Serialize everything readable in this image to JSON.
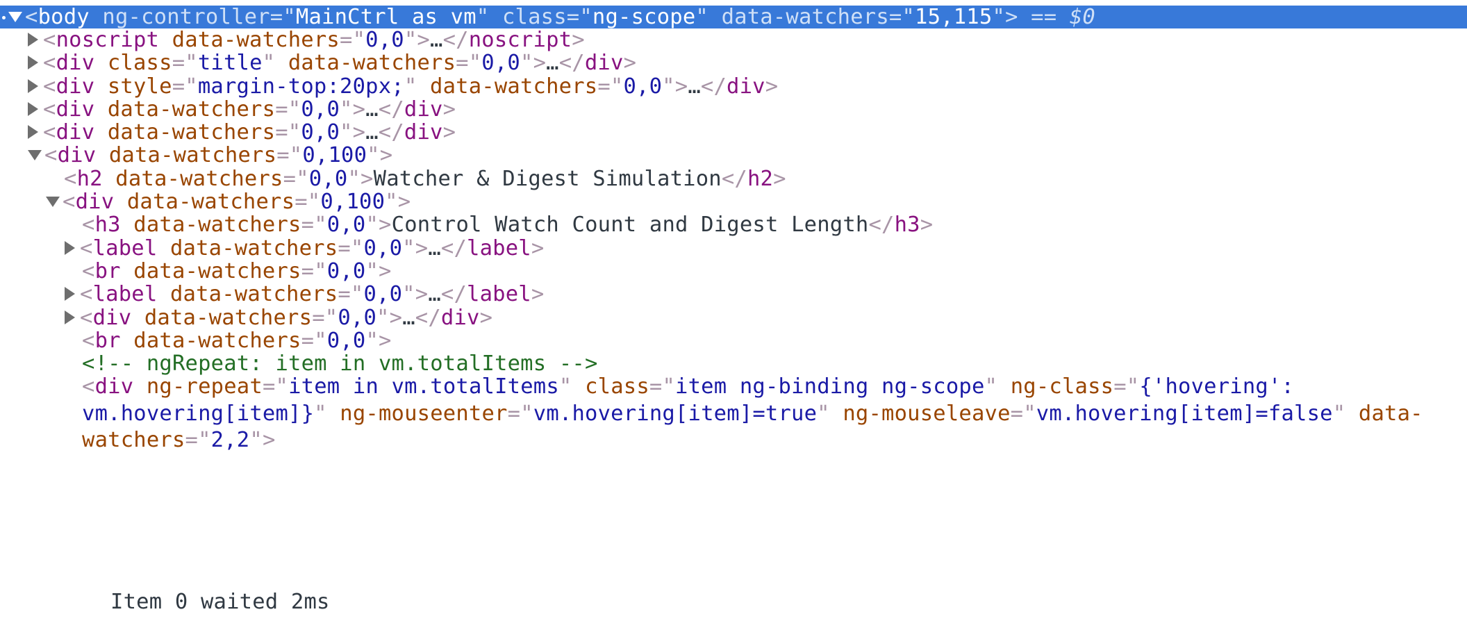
{
  "rows": [
    {
      "indent": 0,
      "selected": true,
      "dot": true,
      "arrow": "expanded",
      "kind": "open",
      "tag": "body",
      "attrs": [
        {
          "n": "ng-controller",
          "v": "MainCtrl as vm"
        },
        {
          "n": "class",
          "v": "ng-scope"
        },
        {
          "n": "data-watchers",
          "v": "15,115"
        }
      ],
      "suffix": " == ",
      "ref": "$0"
    },
    {
      "indent": 1,
      "arrow": "collapsed",
      "kind": "collapsed",
      "tag": "noscript",
      "attrs": [
        {
          "n": "data-watchers",
          "v": "0,0"
        }
      ],
      "ellipsis": "…"
    },
    {
      "indent": 1,
      "arrow": "collapsed",
      "kind": "collapsed",
      "tag": "div",
      "attrs": [
        {
          "n": "class",
          "v": "title"
        },
        {
          "n": "data-watchers",
          "v": "0,0"
        }
      ],
      "ellipsis": "…"
    },
    {
      "indent": 1,
      "arrow": "collapsed",
      "kind": "collapsed",
      "tag": "div",
      "attrs": [
        {
          "n": "style",
          "v": "margin-top:20px;"
        },
        {
          "n": "data-watchers",
          "v": "0,0"
        }
      ],
      "ellipsis": "…"
    },
    {
      "indent": 1,
      "arrow": "collapsed",
      "kind": "collapsed",
      "tag": "div",
      "attrs": [
        {
          "n": "data-watchers",
          "v": "0,0"
        }
      ],
      "ellipsis": "…"
    },
    {
      "indent": 1,
      "arrow": "collapsed",
      "kind": "collapsed",
      "tag": "div",
      "attrs": [
        {
          "n": "data-watchers",
          "v": "0,0"
        }
      ],
      "ellipsis": "…"
    },
    {
      "indent": 1,
      "arrow": "expanded",
      "kind": "open",
      "tag": "div",
      "attrs": [
        {
          "n": "data-watchers",
          "v": "0,100"
        }
      ]
    },
    {
      "indent": 2,
      "arrow": "none",
      "kind": "inline",
      "tag": "h2",
      "attrs": [
        {
          "n": "data-watchers",
          "v": "0,0"
        }
      ],
      "text": "Watcher & Digest Simulation"
    },
    {
      "indent": 2,
      "arrow": "expanded",
      "kind": "open",
      "tag": "div",
      "attrs": [
        {
          "n": "data-watchers",
          "v": "0,100"
        }
      ]
    },
    {
      "indent": 3,
      "arrow": "none",
      "kind": "inline",
      "tag": "h3",
      "attrs": [
        {
          "n": "data-watchers",
          "v": "0,0"
        }
      ],
      "text": "Control Watch Count and Digest Length"
    },
    {
      "indent": 3,
      "arrow": "collapsed",
      "kind": "collapsed",
      "tag": "label",
      "attrs": [
        {
          "n": "data-watchers",
          "v": "0,0"
        }
      ],
      "ellipsis": "…"
    },
    {
      "indent": 3,
      "arrow": "none",
      "kind": "open",
      "tag": "br",
      "attrs": [
        {
          "n": "data-watchers",
          "v": "0,0"
        }
      ]
    },
    {
      "indent": 3,
      "arrow": "collapsed",
      "kind": "collapsed",
      "tag": "label",
      "attrs": [
        {
          "n": "data-watchers",
          "v": "0,0"
        }
      ],
      "ellipsis": "…"
    },
    {
      "indent": 3,
      "arrow": "collapsed",
      "kind": "collapsed",
      "tag": "div",
      "attrs": [
        {
          "n": "data-watchers",
          "v": "0,0"
        }
      ],
      "ellipsis": "…"
    },
    {
      "indent": 3,
      "arrow": "none",
      "kind": "open",
      "tag": "br",
      "attrs": [
        {
          "n": "data-watchers",
          "v": "0,0"
        }
      ]
    },
    {
      "indent": 3,
      "arrow": "none",
      "kind": "comment",
      "comment": "<!-- ngRepeat: item in vm.totalItems -->"
    },
    {
      "indent": 3,
      "arrow": "none",
      "kind": "open",
      "tag": "div",
      "wrap": true,
      "attrs": [
        {
          "n": "ng-repeat",
          "v": "item in vm.totalItems"
        },
        {
          "n": "class",
          "v": "item ng-binding ng-scope"
        },
        {
          "n": "ng-class",
          "v": "{'hovering': vm.hovering[item]}"
        },
        {
          "n": "ng-mouseenter",
          "v": "vm.hovering[item]=true"
        },
        {
          "n": "ng-mouseleave",
          "v": "vm.hovering[item]=false"
        },
        {
          "n": "data-watchers",
          "v": "2,2"
        }
      ]
    },
    {
      "indent": 3,
      "arrow": "none",
      "kind": "text",
      "text": "Item 0 waited 2ms"
    }
  ]
}
